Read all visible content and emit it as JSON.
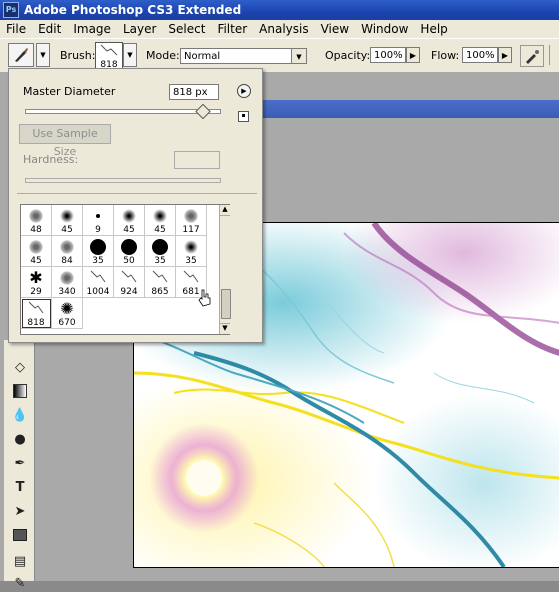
{
  "title_bar": {
    "icon": "Ps",
    "title": "Adobe Photoshop CS3 Extended"
  },
  "menu": [
    "File",
    "Edit",
    "Image",
    "Layer",
    "Select",
    "Filter",
    "Analysis",
    "View",
    "Window",
    "Help"
  ],
  "options_bar": {
    "brush_label": "Brush:",
    "brush_size": "818",
    "mode_label": "Mode:",
    "mode_value": "Normal",
    "opacity_label": "Opacity:",
    "opacity_value": "100%",
    "flow_label": "Flow:",
    "flow_value": "100%"
  },
  "brush_picker": {
    "master_diameter_label": "Master Diameter",
    "master_diameter_value": "818 px",
    "master_diameter_level": 0.91,
    "use_sample_size": "Use Sample Size",
    "hardness_label": "Hardness:",
    "hardness_value": "",
    "brushes": [
      {
        "size": "48",
        "kind": "texture"
      },
      {
        "size": "45",
        "kind": "soft"
      },
      {
        "size": "9",
        "kind": "hard"
      },
      {
        "size": "45",
        "kind": "soft"
      },
      {
        "size": "45",
        "kind": "soft"
      },
      {
        "size": "117",
        "kind": "texture"
      },
      {
        "size": "45",
        "kind": "texture"
      },
      {
        "size": "84",
        "kind": "texture"
      },
      {
        "size": "35",
        "kind": "hard"
      },
      {
        "size": "50",
        "kind": "hard"
      },
      {
        "size": "35",
        "kind": "hard"
      },
      {
        "size": "35",
        "kind": "soft"
      },
      {
        "size": "29",
        "kind": "butterfly"
      },
      {
        "size": "340",
        "kind": "texture"
      },
      {
        "size": "1004",
        "kind": "lightning"
      },
      {
        "size": "924",
        "kind": "lightning"
      },
      {
        "size": "865",
        "kind": "lightning"
      },
      {
        "size": "681",
        "kind": "lightning"
      },
      {
        "size": "818",
        "kind": "lightning",
        "selected": true
      },
      {
        "size": "670",
        "kind": "sunburst"
      }
    ]
  },
  "colors": {
    "titlebar": "#1c44b0",
    "chrome": "#ece9d8",
    "workspace": "#a9a9a9"
  }
}
